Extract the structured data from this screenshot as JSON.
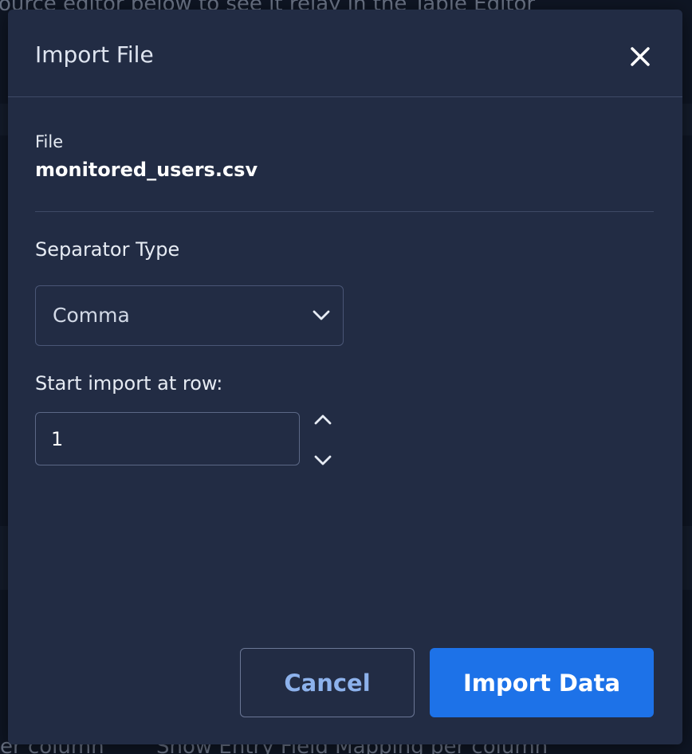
{
  "background": {
    "top_text": "ource editor below to see it relay in the Table Editor",
    "bottom_left_text": "er column",
    "bottom_right_text": "Show Entry Field Mapping per column"
  },
  "dialog": {
    "title": "Import File",
    "close_icon": "close-icon",
    "file_label": "File",
    "file_name": "monitored_users.csv",
    "separator_label": "Separator Type",
    "separator_value": "Comma",
    "separator_icon": "chevron-down-icon",
    "start_row_label": "Start import at row:",
    "start_row_value": "1",
    "cancel_label": "Cancel",
    "import_label": "Import Data"
  },
  "colors": {
    "dialog_bg": "#222c44",
    "primary": "#1d72e8",
    "cancel_text": "#8db2ec"
  }
}
